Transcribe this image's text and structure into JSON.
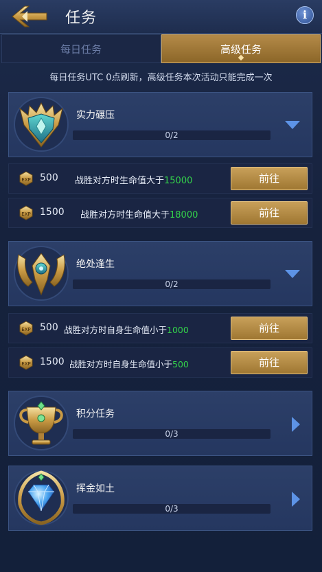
{
  "header": {
    "title": "任务"
  },
  "tabs": [
    {
      "label": "每日任务",
      "active": false
    },
    {
      "label": "高级任务",
      "active": true
    }
  ],
  "notice": "每日任务UTC 0点刷新，高级任务本次活动只能完成一次",
  "groups": [
    {
      "name": "实力碾压",
      "progress": "0/2",
      "expanded": true,
      "tasks": [
        {
          "points": "500",
          "desc": "战胜对方时生命值大于",
          "value": "15000",
          "button": "前往"
        },
        {
          "points": "1500",
          "desc": "战胜对方时生命值大于",
          "value": "18000",
          "button": "前往"
        }
      ]
    },
    {
      "name": "绝处逢生",
      "progress": "0/2",
      "expanded": true,
      "tasks": [
        {
          "points": "500",
          "desc": "战胜对方时自身生命值小于",
          "value": "1000",
          "button": "前往"
        },
        {
          "points": "1500",
          "desc": "战胜对方时自身生命值小于",
          "value": "500",
          "button": "前往"
        }
      ]
    },
    {
      "name": "积分任务",
      "progress": "0/3",
      "expanded": false
    },
    {
      "name": "挥金如土",
      "progress": "0/3",
      "expanded": false
    }
  ],
  "exp_label": "EXP",
  "colors": {
    "accent_gold": "#b48a48",
    "value_green": "#33d24a",
    "card_blue": "#2c3f68"
  },
  "icons": {
    "back": "back-arrow-icon",
    "info": "info-icon",
    "expanded_arrow": "chevron-down-icon",
    "collapsed_arrow": "chevron-right-icon"
  }
}
